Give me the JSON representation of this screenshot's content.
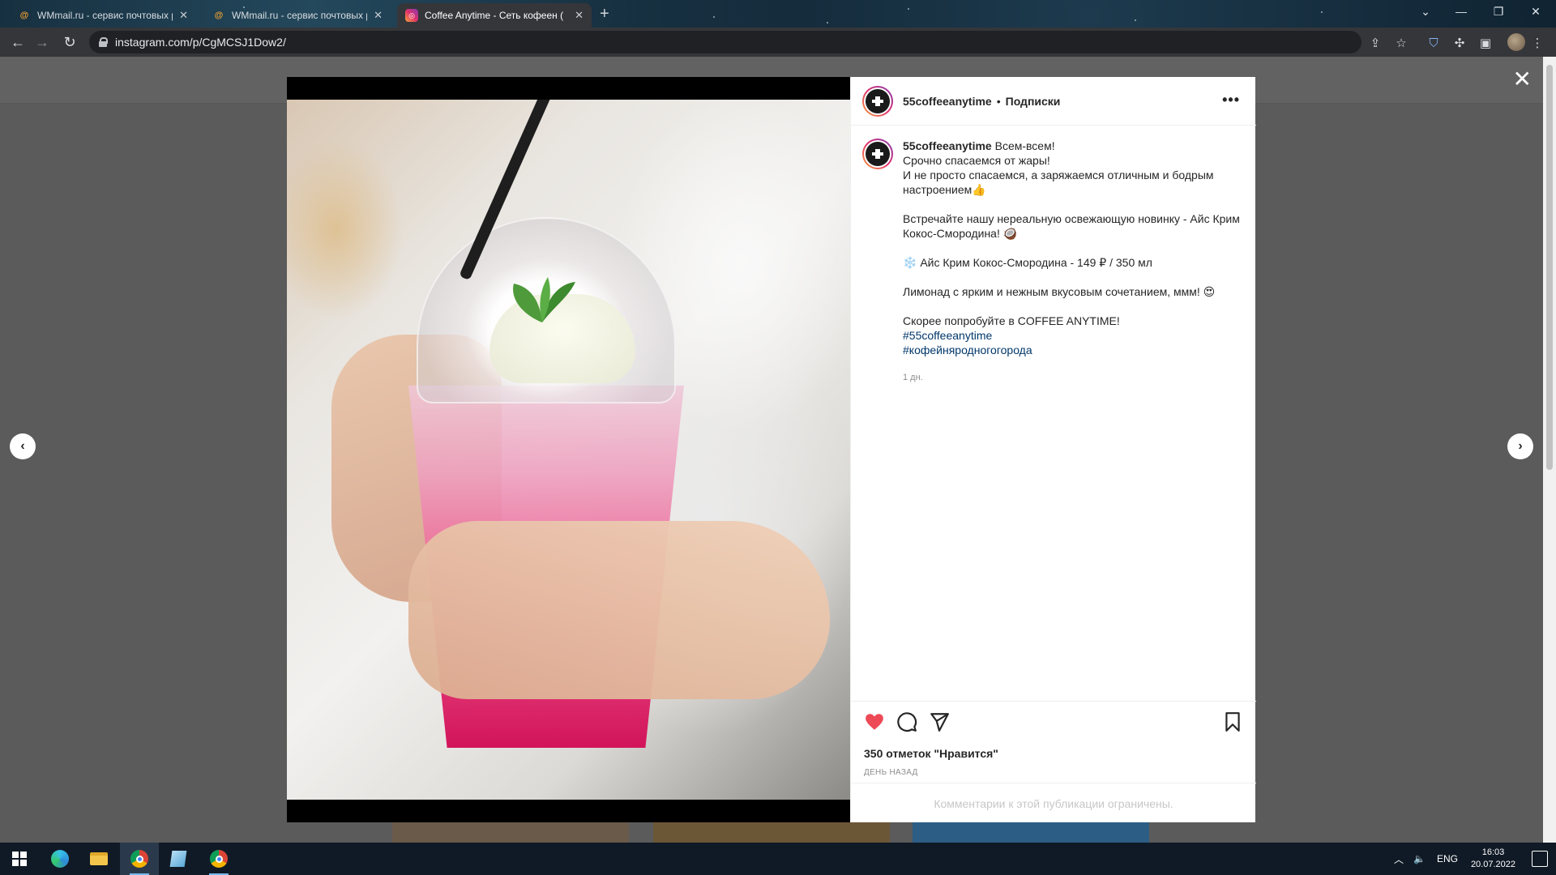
{
  "browser": {
    "tabs": [
      {
        "title": "WMmail.ru - сервис почтовых р",
        "favicon": "wmmail-icon",
        "active": false
      },
      {
        "title": "WMmail.ru - сервис почтовых р",
        "favicon": "wmmail-icon",
        "active": false
      },
      {
        "title": "Coffee Anytime - Сеть кофеен (",
        "favicon": "instagram-icon",
        "active": true
      }
    ],
    "new_tab_label": "+",
    "url": "instagram.com/p/CgMCSJ1Dow2/"
  },
  "post": {
    "username": "55coffeeanytime",
    "follow_label": "Подписки",
    "caption": {
      "username": "55coffeeanytime",
      "line1": "Всем-всем!",
      "line2": "Срочно спасаемся от жары!",
      "line3": "И не просто спасаемся, а заряжаемся отличным и бодрым настроением👍",
      "para2": "Встречайте нашу нереальную освежающую новинку - Айс Крим Кокос-Смородина! 🥥",
      "para3": "❄️ Айс Крим Кокос-Смородина - 149 ₽ / 350 мл",
      "para4": "Лимонад с ярким и нежным вкусовым сочетанием, ммм! 😍",
      "para5": "Скорее попробуйте в COFFEE ANYTIME!",
      "tags": [
        "#55coffeeanytime",
        "#кофейняродногогорода"
      ],
      "time": "1 дн."
    },
    "likes_text": "350 отметок \"Нравится\"",
    "posted_text": "ДЕНЬ НАЗАД",
    "comments_limited": "Комментарии к этой публикации ограничены.",
    "colors": {
      "like": "#ed4956",
      "link": "#00376b"
    }
  },
  "taskbar": {
    "tray_lang": "ENG",
    "time": "16:03",
    "date": "20.07.2022"
  }
}
